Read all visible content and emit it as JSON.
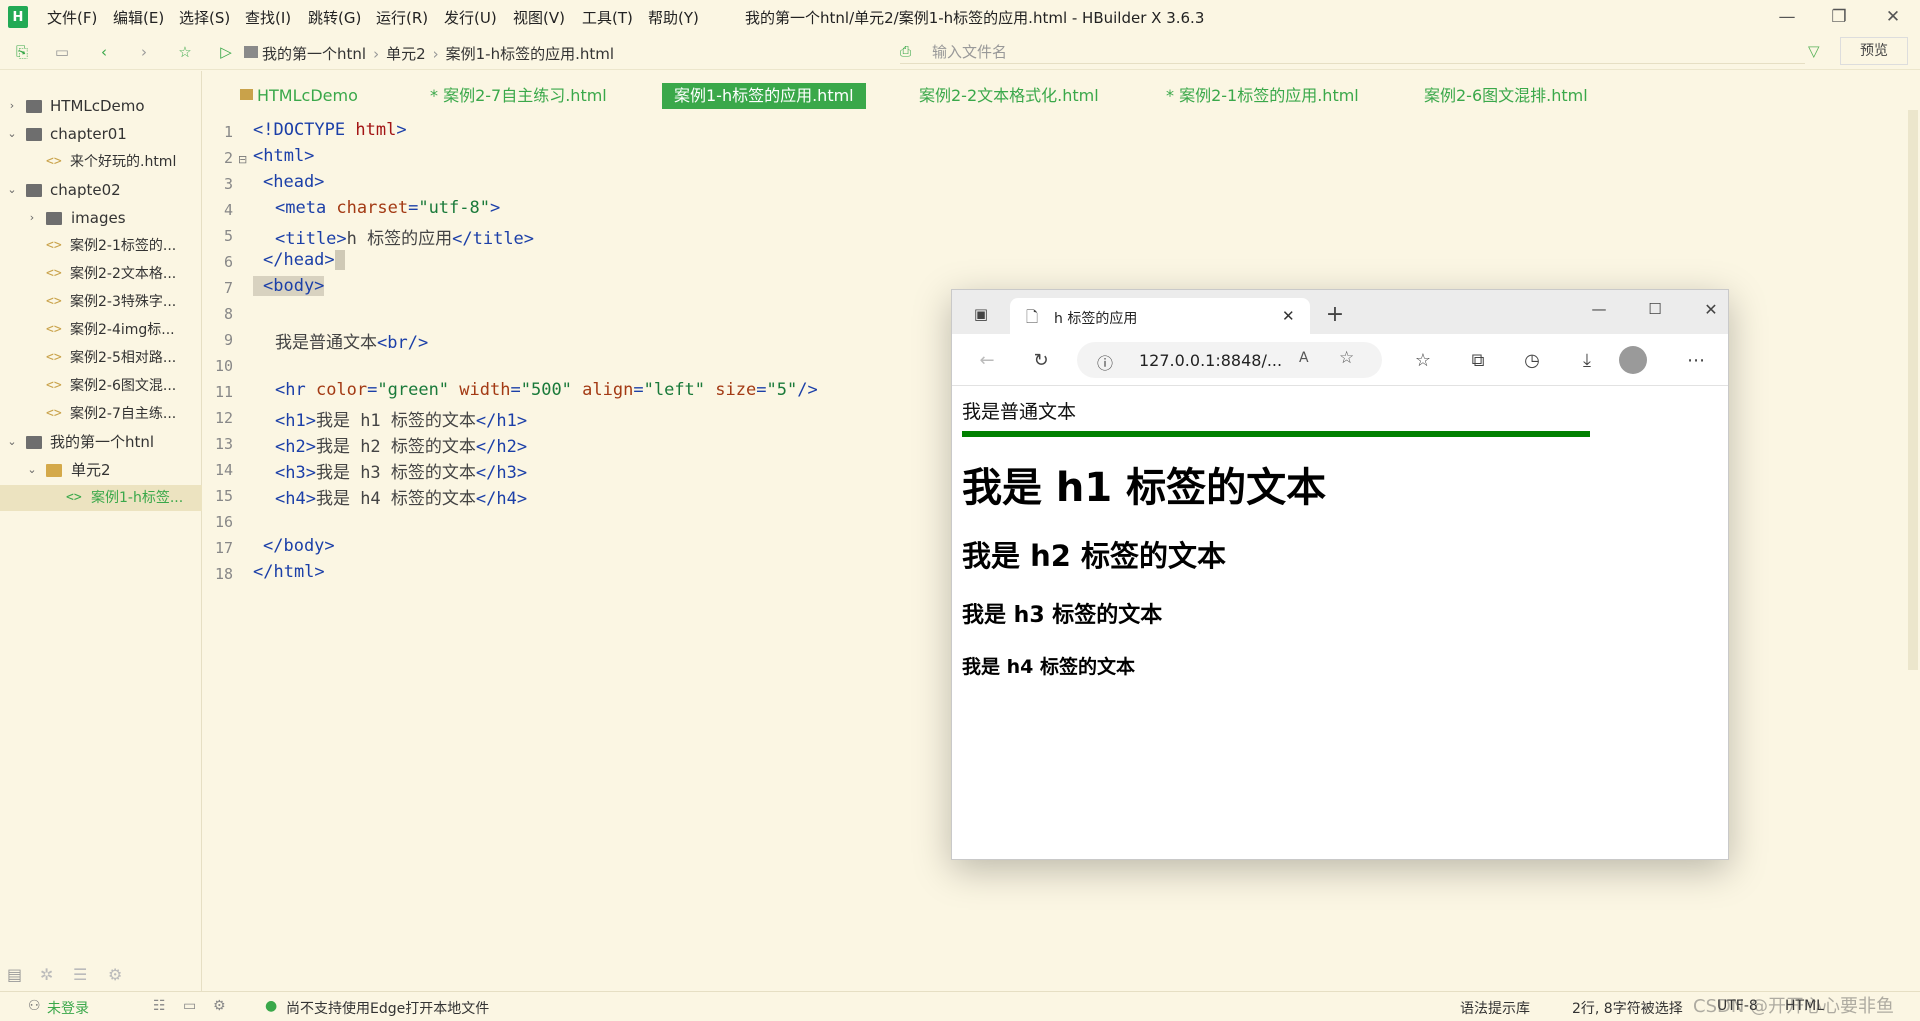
{
  "app": {
    "logo_letter": "H",
    "window_title": "我的第一个htnl/单元2/案例1-h标签的应用.html - HBuilder X 3.6.3"
  },
  "menu": [
    {
      "label": "文件(F)"
    },
    {
      "label": "编辑(E)"
    },
    {
      "label": "选择(S)"
    },
    {
      "label": "查找(I)"
    },
    {
      "label": "跳转(G)"
    },
    {
      "label": "运行(R)"
    },
    {
      "label": "发行(U)"
    },
    {
      "label": "视图(V)"
    },
    {
      "label": "工具(T)"
    },
    {
      "label": "帮助(Y)"
    }
  ],
  "window_controls": {
    "minimize": "—",
    "maximize": "❐",
    "close": "✕"
  },
  "toolbar": {
    "breadcrumb": [
      "我的第一个htnl",
      "单元2",
      "案例1-h标签的应用.html"
    ],
    "file_search_placeholder": "输入文件名",
    "preview_label": "预览"
  },
  "sidebar": {
    "items": [
      {
        "label": "HTMLcDemo",
        "type": "folder",
        "expanded": false,
        "level": 0
      },
      {
        "label": "chapter01",
        "type": "folder",
        "expanded": true,
        "level": 0
      },
      {
        "label": "来个好玩的.html",
        "type": "file",
        "level": 1
      },
      {
        "label": "chapte02",
        "type": "folder",
        "expanded": true,
        "level": 0
      },
      {
        "label": "images",
        "type": "folder",
        "expanded": false,
        "level": 1
      },
      {
        "label": "案例2-1标签的...",
        "type": "file",
        "level": 1
      },
      {
        "label": "案例2-2文本格...",
        "type": "file",
        "level": 1
      },
      {
        "label": "案例2-3特殊字...",
        "type": "file",
        "level": 1
      },
      {
        "label": "案例2-4img标...",
        "type": "file",
        "level": 1
      },
      {
        "label": "案例2-5相对路...",
        "type": "file",
        "level": 1
      },
      {
        "label": "案例2-6图文混...",
        "type": "file",
        "level": 1
      },
      {
        "label": "案例2-7自主练...",
        "type": "file",
        "level": 1
      },
      {
        "label": "我的第一个htnl",
        "type": "folder",
        "expanded": true,
        "level": 0
      },
      {
        "label": "单元2",
        "type": "folder-open",
        "expanded": true,
        "level": 1
      },
      {
        "label": "案例1-h标签...",
        "type": "file",
        "level": 2,
        "selected": true
      }
    ]
  },
  "tabs": [
    {
      "label": "HTMLcDemo",
      "active": false
    },
    {
      "label": "* 案例2-7自主练习.html",
      "active": false
    },
    {
      "label": "案例1-h标签的应用.html",
      "active": true
    },
    {
      "label": "案例2-2文本格式化.html",
      "active": false
    },
    {
      "label": "* 案例2-1标签的应用.html",
      "active": false
    },
    {
      "label": "案例2-6图文混排.html",
      "active": false
    }
  ],
  "editor": {
    "line_numbers": [
      "1",
      "2",
      "3",
      "4",
      "5",
      "6",
      "7",
      "8",
      "9",
      "10",
      "11",
      "12",
      "13",
      "14",
      "15",
      "16",
      "17",
      "18"
    ],
    "code": {
      "l1_a": "<!DOCTYPE ",
      "l1_b": "html",
      "l1_c": ">",
      "l2": "<html>",
      "l3": "<head>",
      "l4_a": "<meta ",
      "l4_b": "charset",
      "l4_c": "=",
      "l4_d": "\"utf-8\"",
      "l4_e": ">",
      "l5_a": "<title>",
      "l5_b": "h 标签的应用",
      "l5_c": "</title>",
      "l6": "</head>",
      "l7": "<body>",
      "l9_a": "我是普通文本",
      "l9_b": "<br/>",
      "l11_a": "<hr ",
      "l11_b": "color",
      "l11_c": "=",
      "l11_d": "\"green\"",
      "l11_e": " ",
      "l11_f": "width",
      "l11_g": "=",
      "l11_h": "\"500\"",
      "l11_i": " ",
      "l11_j": "align",
      "l11_k": "=",
      "l11_l": "\"left\"",
      "l11_m": " ",
      "l11_n": "size",
      "l11_o": "=",
      "l11_p": "\"5\"",
      "l11_q": "/>",
      "l12_a": "<h1>",
      "l12_b": "我是 h1 标签的文本",
      "l12_c": "</h1>",
      "l13_a": "<h2>",
      "l13_b": "我是 h2 标签的文本",
      "l13_c": "</h2>",
      "l14_a": "<h3>",
      "l14_b": "我是 h3 标签的文本",
      "l14_c": "</h3>",
      "l15_a": "<h4>",
      "l15_b": "我是 h4 标签的文本",
      "l15_c": "</h4>",
      "l17": "</body>",
      "l18": "</html>"
    }
  },
  "browser": {
    "tab_title": "h 标签的应用",
    "address": "127.0.0.1:8848/...",
    "page": {
      "text": "我是普通文本",
      "hr_color": "#008000",
      "h1": "我是 h1 标签的文本",
      "h2": "我是 h2 标签的文本",
      "h3": "我是 h3 标签的文本",
      "h4": "我是 h4 标签的文本"
    }
  },
  "statusbar": {
    "login": "未登录",
    "message": "尚不支持使用Edge打开本地文件",
    "syntax_hint": "语法提示库",
    "position": "2行, 8字符被选择",
    "encoding": "UTF-8",
    "language": "HTML",
    "watermark": "CSDN @开开心心要非鱼"
  }
}
